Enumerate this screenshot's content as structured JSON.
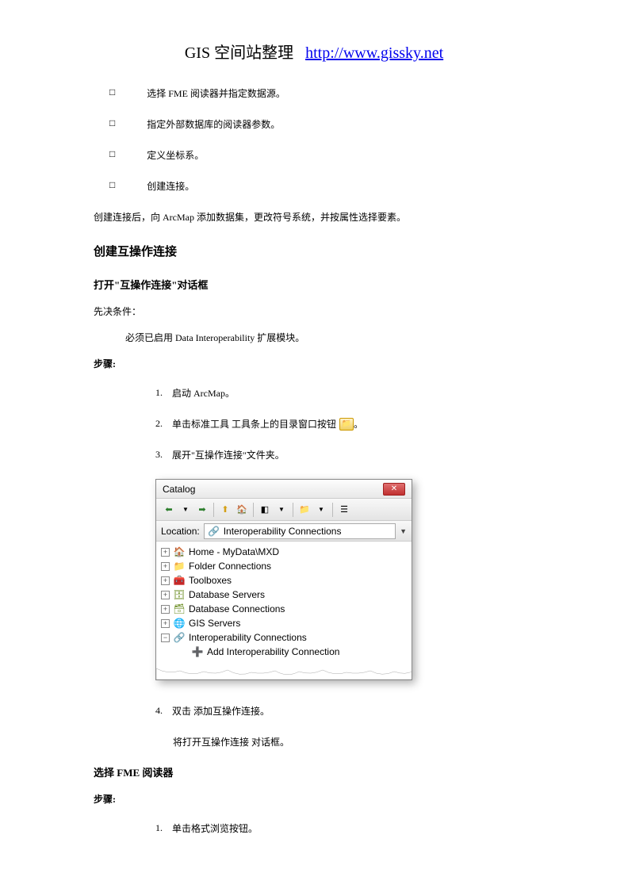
{
  "header": {
    "site_name": "GIS 空间站整理",
    "url": "http://www.gissky.net"
  },
  "bullets": [
    "选择 FME 阅读器并指定数据源。",
    "指定外部数据库的阅读器参数。",
    "定义坐标系。",
    "创建连接。"
  ],
  "after_bullets": "创建连接后，向 ArcMap 添加数据集，更改符号系统，并按属性选择要素。",
  "section1": {
    "title": "创建互操作连接",
    "sub1_title": "打开\"互操作连接\"对话框",
    "prereq_label": "先决条件：",
    "prereq_text": "必须已启用 Data Interoperability 扩展模块。",
    "steps_label": "步骤:",
    "steps": [
      "启动 ArcMap。",
      "单击标准工具 工具条上的目录窗口按钮",
      "展开\"互操作连接\"文件夹。",
      "双击 添加互操作连接。"
    ],
    "step4_sub": "将打开互操作连接 对话框。"
  },
  "catalog": {
    "title": "Catalog",
    "location_label": "Location:",
    "location_value": "Interoperability Connections",
    "tree": [
      {
        "label": "Home - MyData\\MXD",
        "icon": "folder-home",
        "expand": "+"
      },
      {
        "label": "Folder Connections",
        "icon": "folder",
        "expand": "+"
      },
      {
        "label": "Toolboxes",
        "icon": "toolbox",
        "expand": "+"
      },
      {
        "label": "Database Servers",
        "icon": "db-server",
        "expand": "+"
      },
      {
        "label": "Database Connections",
        "icon": "db-conn",
        "expand": "+"
      },
      {
        "label": "GIS Servers",
        "icon": "gis-server",
        "expand": "+"
      },
      {
        "label": "Interoperability Connections",
        "icon": "interop",
        "expand": "−"
      },
      {
        "label": "Add Interoperability Connection",
        "icon": "interop-add",
        "expand": "",
        "indent": 1
      }
    ]
  },
  "section2": {
    "title": "选择 FME 阅读器",
    "steps_label": "步骤:",
    "steps": [
      "单击格式浏览按钮。"
    ]
  }
}
